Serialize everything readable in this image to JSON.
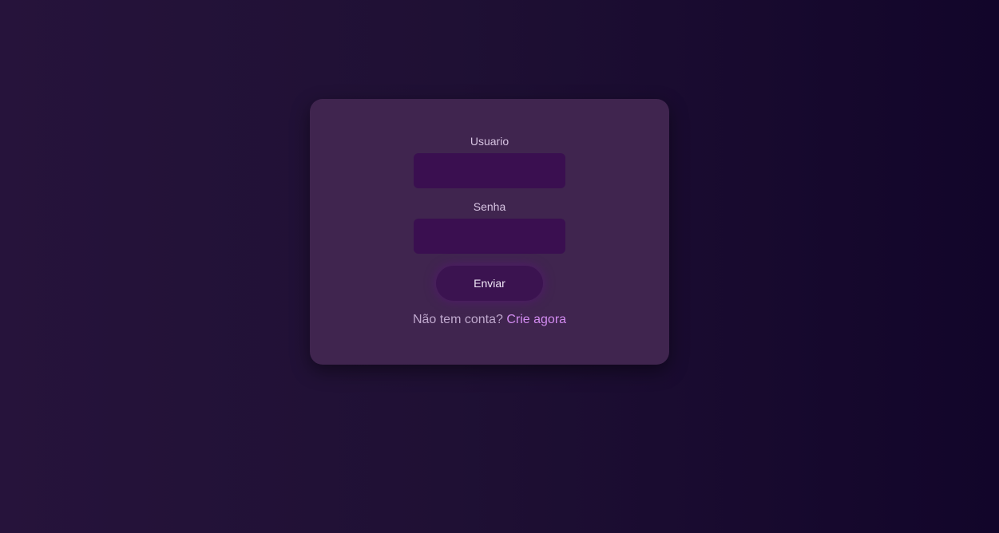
{
  "login": {
    "username_label": "Usuario",
    "username_value": "",
    "password_label": "Senha",
    "password_value": "",
    "submit_label": "Enviar",
    "signup_prompt": "Não tem conta?",
    "signup_link": "Crie agora"
  },
  "colors": {
    "background_left": "#26133b",
    "background_right": "#12052a",
    "card": "#40254f",
    "input": "#3a0f50",
    "button": "#3b1350",
    "link": "#d28bf0"
  }
}
